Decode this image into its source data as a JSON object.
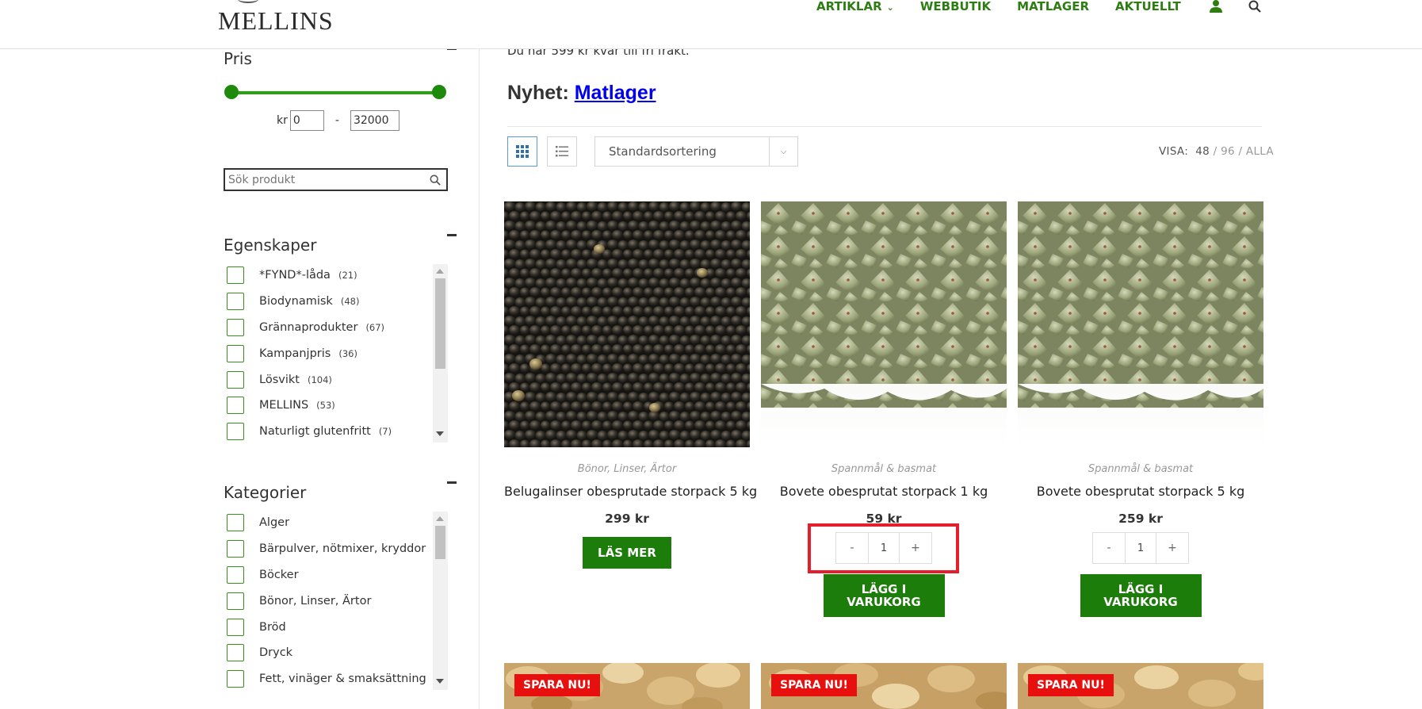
{
  "header": {
    "logo": "MELLINS",
    "nav": [
      {
        "label": "ARTIKLAR",
        "has_dropdown": true
      },
      {
        "label": "WEBBUTIK"
      },
      {
        "label": "MATLAGER"
      },
      {
        "label": "AKTUELLT"
      }
    ],
    "icons": [
      "user-icon",
      "search-icon"
    ]
  },
  "sidebar": {
    "price": {
      "title": "Pris",
      "currency": "kr",
      "min": "0",
      "max": "32000",
      "separator": "-"
    },
    "search": {
      "placeholder": "Sök produkt"
    },
    "properties": {
      "title": "Egenskaper",
      "items": [
        {
          "label": "*FYND*-låda",
          "count": "(21)"
        },
        {
          "label": "Biodynamisk",
          "count": "(48)"
        },
        {
          "label": "Grännaprodukter",
          "count": "(67)"
        },
        {
          "label": "Kampanjpris",
          "count": "(36)"
        },
        {
          "label": "Lösvikt",
          "count": "(104)"
        },
        {
          "label": "MELLINS",
          "count": "(53)"
        },
        {
          "label": "Naturligt glutenfritt",
          "count": "(7)"
        }
      ]
    },
    "categories": {
      "title": "Kategorier",
      "items": [
        {
          "label": "Alger"
        },
        {
          "label": "Bärpulver, nötmixer, kryddor"
        },
        {
          "label": "Böcker"
        },
        {
          "label": "Bönor, Linser, Ärtor"
        },
        {
          "label": "Bröd"
        },
        {
          "label": "Dryck"
        },
        {
          "label": "Fett, vinäger & smaksättning"
        }
      ]
    }
  },
  "main": {
    "notice": "Du har 599 kr kvar till fri frakt.",
    "promo_prefix": "Nyhet: ",
    "promo_link": "Matlager",
    "sort_label": "Standardsortering",
    "visa": {
      "label": "VISA:",
      "current": "48",
      "sep1": " / ",
      "opt1": "96",
      "sep2": " / ",
      "opt2": "ALLA"
    },
    "products": [
      {
        "category": "Bönor, Linser, Ärtor",
        "title": "Belugalinser obesprutade storpack 5 kg",
        "price": "299 kr",
        "button": "LÄS MER"
      },
      {
        "category": "Spannmål & basmat",
        "title": "Bovete obesprutat storpack 1 kg",
        "price": "59 kr",
        "qty_minus": "-",
        "qty": "1",
        "qty_plus": "+",
        "button_line1": "LÄGG I",
        "button_line2": "VARUKORG"
      },
      {
        "category": "Spannmål & basmat",
        "title": "Bovete obesprutat storpack 5 kg",
        "price": "259 kr",
        "qty_minus": "-",
        "qty": "1",
        "qty_plus": "+",
        "button_line1": "LÄGG I",
        "button_line2": "VARUKORG"
      }
    ],
    "badge": "SPARA NU!"
  },
  "colors": {
    "brand_green": "#1d7d0b",
    "nav_green": "#2e7d12",
    "badge_red": "#e8100f",
    "highlight_red": "#e41e2b",
    "link_blue": "#0000ee"
  }
}
